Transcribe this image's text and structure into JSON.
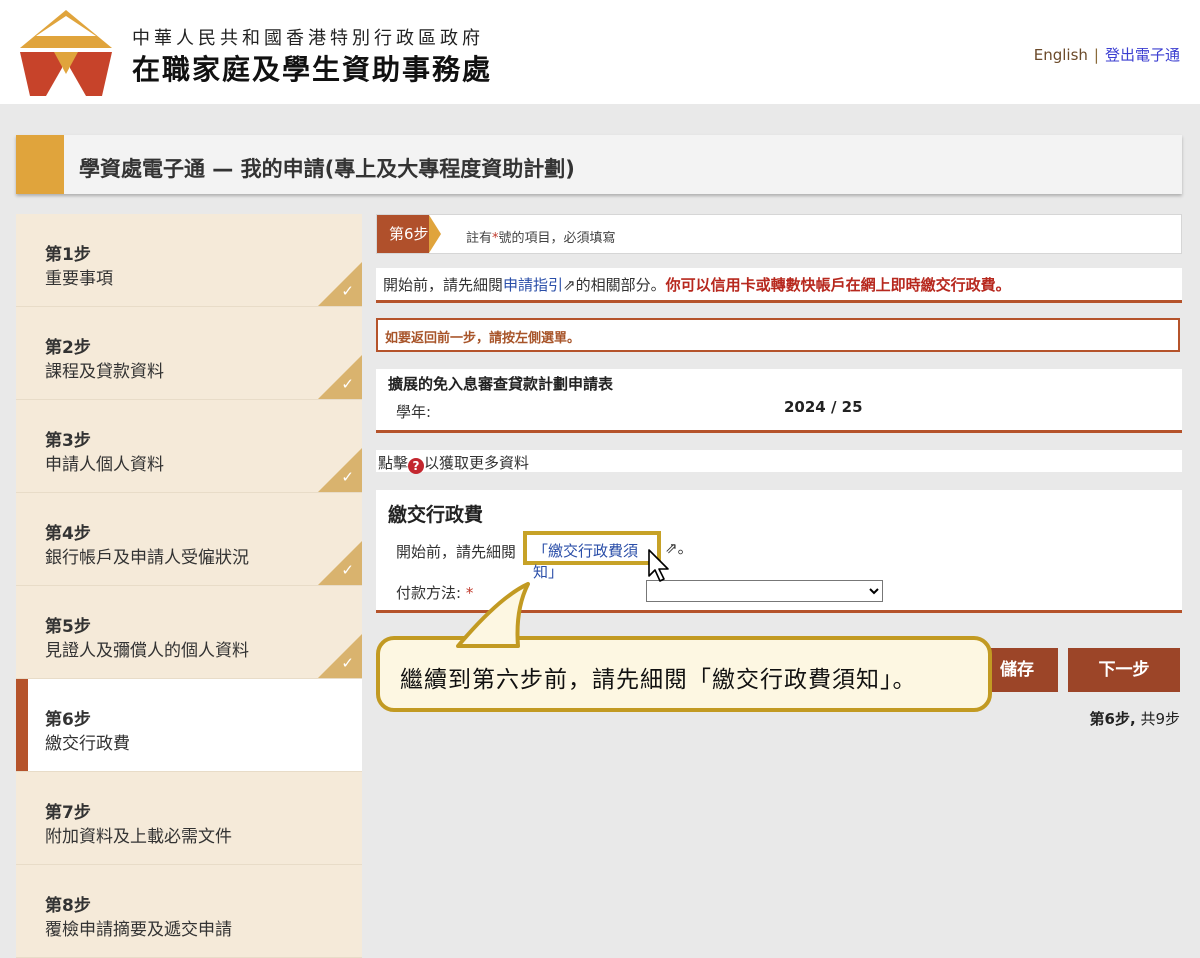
{
  "header": {
    "gov_name": "中華人民共和國香港特別行政區政府",
    "dept_name": "在職家庭及學生資助事務處",
    "lang_link": "English",
    "separator": "|",
    "logout_link": "登出電子通"
  },
  "page_title": "學資處電子通 — 我的申請(專上及大專程度資助計劃)",
  "sidebar": {
    "steps": [
      {
        "num": "第1步",
        "label": "重要事項",
        "done": true
      },
      {
        "num": "第2步",
        "label": "課程及貸款資料",
        "done": true
      },
      {
        "num": "第3步",
        "label": "申請人個人資料",
        "done": true
      },
      {
        "num": "第4步",
        "label": "銀行帳戶及申請人受僱狀況",
        "done": true
      },
      {
        "num": "第5步",
        "label": "見證人及彌償人的個人資料",
        "done": true
      },
      {
        "num": "第6步",
        "label": "繳交行政費",
        "done": false,
        "active": true
      },
      {
        "num": "第7步",
        "label": "附加資料及上載必需文件",
        "done": false
      },
      {
        "num": "第8步",
        "label": "覆檢申請摘要及遞交申請",
        "done": false
      }
    ],
    "check_glyph": "✓"
  },
  "stepbar": {
    "badge": "第6步",
    "note_pre": "註有",
    "note_star": "*",
    "note_post": "號的項目，必須填寫"
  },
  "intro": {
    "pre": "開始前，請先細閱",
    "link": "申請指引",
    "ext": "⇗",
    "mid": "的相關部分。",
    "red": "你可以信用卡或轉數快帳戶在網上即時繳交行政費。"
  },
  "back_note": "如要返回前一步，請按左側選單。",
  "form": {
    "title": "擴展的免入息審查貸款計劃申請表",
    "year_label": "學年:",
    "year_value": "2024 / 25"
  },
  "more_info": {
    "pre": "點擊",
    "icon": "?",
    "post": "以獲取更多資料"
  },
  "fee": {
    "heading": "繳交行政費",
    "pre": "開始前，請先細閱",
    "link": "「繳交行政費須知」",
    "ext": "⇗。",
    "pay_label": "付款方法:",
    "pay_star": "*",
    "pay_value": ""
  },
  "buttons": {
    "save": "儲存",
    "next": "下一步"
  },
  "progress": {
    "current": "第6步,",
    "total": "共9步"
  },
  "callout": "繼續到第六步前，請先細閱「繳交行政費須知」。",
  "colors": {
    "accent_orange": "#e0a43c",
    "accent_brown": "#b5532b",
    "button": "#9c4528",
    "callout_border": "#c29a22"
  }
}
